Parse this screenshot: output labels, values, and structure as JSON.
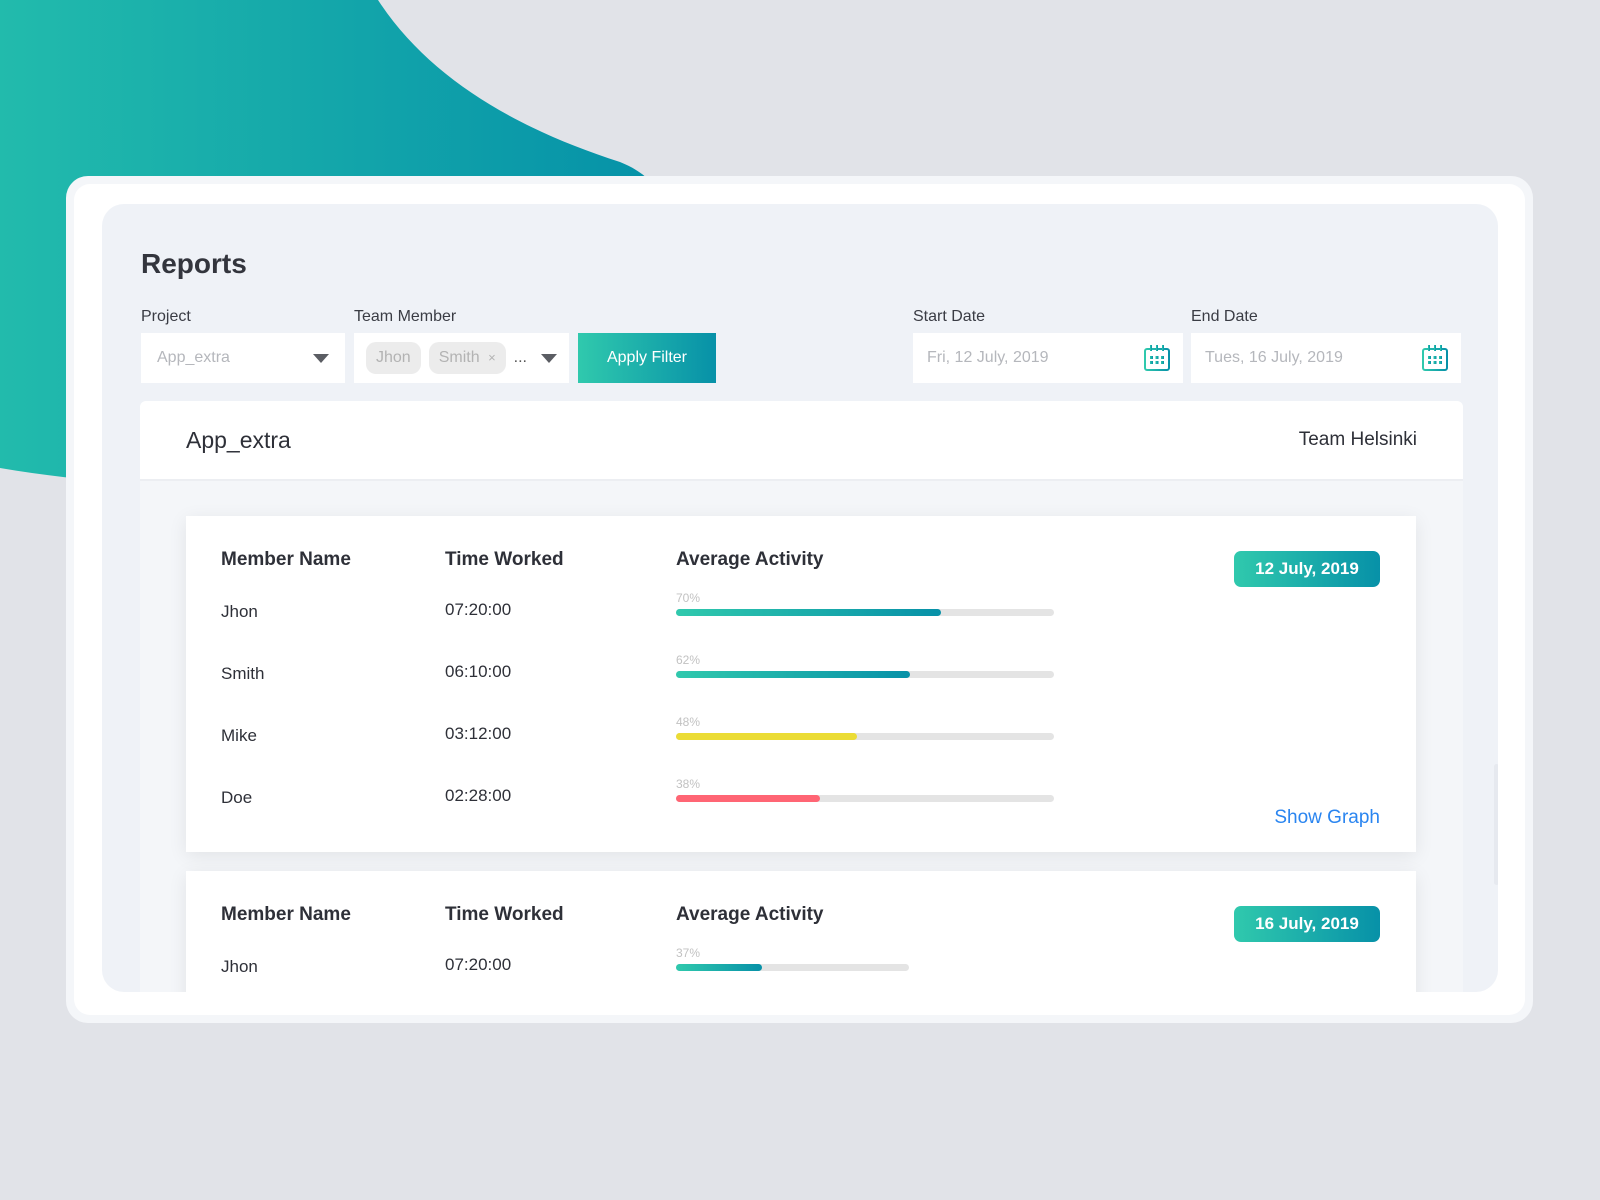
{
  "colors": {
    "accent_start": "#30c9ad",
    "accent_end": "#0791a8",
    "yellow": "#ebdc35",
    "red": "#ff6574",
    "link": "#2a85f0"
  },
  "page": {
    "title": "Reports"
  },
  "filters": {
    "project": {
      "label": "Project",
      "value": "App_extra"
    },
    "team_member": {
      "label": "Team Member",
      "chips": [
        "Jhon",
        "Smith"
      ],
      "remove": "×",
      "more": "..."
    },
    "apply_label": "Apply Filter",
    "start_date": {
      "label": "Start Date",
      "value": "Fri, 12 July, 2019"
    },
    "end_date": {
      "label": "End Date",
      "value": "Tues, 16 July, 2019"
    }
  },
  "report": {
    "project": "App_extra",
    "team": "Team Helsinki",
    "columns": [
      "Member Name",
      "Time Worked",
      "Average Activity"
    ],
    "groups": [
      {
        "date": "12 July, 2019",
        "show_graph": "Show Graph",
        "rows": [
          {
            "name": "Jhon",
            "time": "07:20:00",
            "activity": 70,
            "activity_label": "70%",
            "color": "gradient"
          },
          {
            "name": "Smith",
            "time": "06:10:00",
            "activity": 62,
            "activity_label": "62%",
            "color": "gradient"
          },
          {
            "name": "Mike",
            "time": "03:12:00",
            "activity": 48,
            "activity_label": "48%",
            "color": "#ebdc35"
          },
          {
            "name": "Doe",
            "time": "02:28:00",
            "activity": 38,
            "activity_label": "38%",
            "color": "#ff6574"
          }
        ]
      },
      {
        "date": "16 July, 2019",
        "rows": [
          {
            "name": "Jhon",
            "time": "07:20:00",
            "activity": 37,
            "activity_label": "37%",
            "color": "gradient"
          }
        ]
      }
    ]
  }
}
